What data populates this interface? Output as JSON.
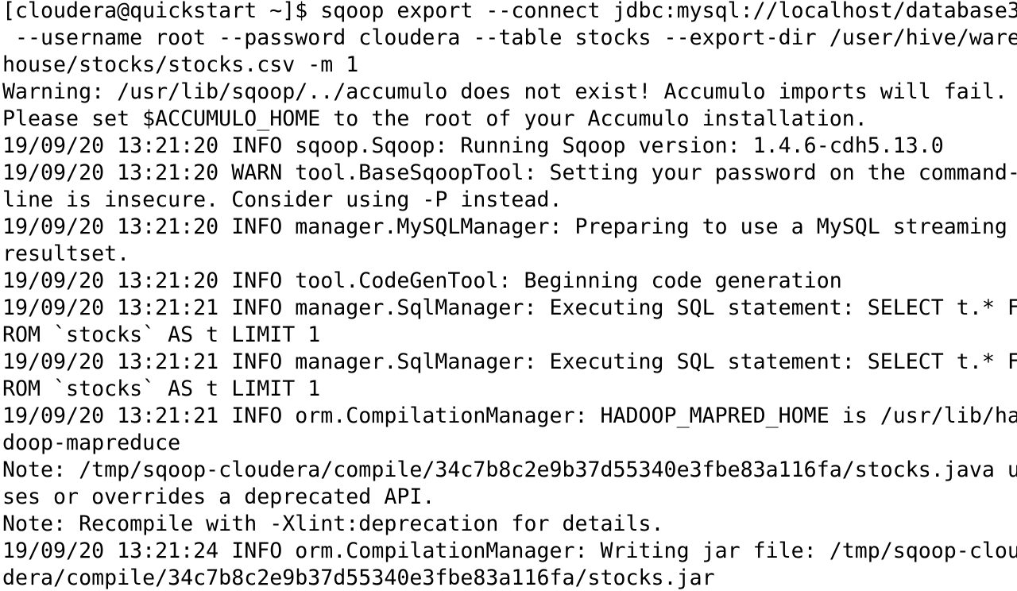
{
  "terminal": {
    "lines": [
      "[cloudera@quickstart ~]$ sqoop export --connect jdbc:mysql://localhost/database3",
      " --username root --password cloudera --table stocks --export-dir /user/hive/ware",
      "house/stocks/stocks.csv -m 1",
      "Warning: /usr/lib/sqoop/../accumulo does not exist! Accumulo imports will fail.",
      "Please set $ACCUMULO_HOME to the root of your Accumulo installation.",
      "19/09/20 13:21:20 INFO sqoop.Sqoop: Running Sqoop version: 1.4.6-cdh5.13.0",
      "19/09/20 13:21:20 WARN tool.BaseSqoopTool: Setting your password on the command-",
      "line is insecure. Consider using -P instead.",
      "19/09/20 13:21:20 INFO manager.MySQLManager: Preparing to use a MySQL streaming",
      "resultset.",
      "19/09/20 13:21:20 INFO tool.CodeGenTool: Beginning code generation",
      "19/09/20 13:21:21 INFO manager.SqlManager: Executing SQL statement: SELECT t.* F",
      "ROM `stocks` AS t LIMIT 1",
      "19/09/20 13:21:21 INFO manager.SqlManager: Executing SQL statement: SELECT t.* F",
      "ROM `stocks` AS t LIMIT 1",
      "19/09/20 13:21:21 INFO orm.CompilationManager: HADOOP_MAPRED_HOME is /usr/lib/ha",
      "doop-mapreduce",
      "Note: /tmp/sqoop-cloudera/compile/34c7b8c2e9b37d55340e3fbe83a116fa/stocks.java u",
      "ses or overrides a deprecated API.",
      "Note: Recompile with -Xlint:deprecation for details.",
      "19/09/20 13:21:24 INFO orm.CompilationManager: Writing jar file: /tmp/sqoop-clou",
      "dera/compile/34c7b8c2e9b37d55340e3fbe83a116fa/stocks.jar"
    ]
  },
  "colors": {
    "background": "#ffffff",
    "text": "#000000"
  }
}
